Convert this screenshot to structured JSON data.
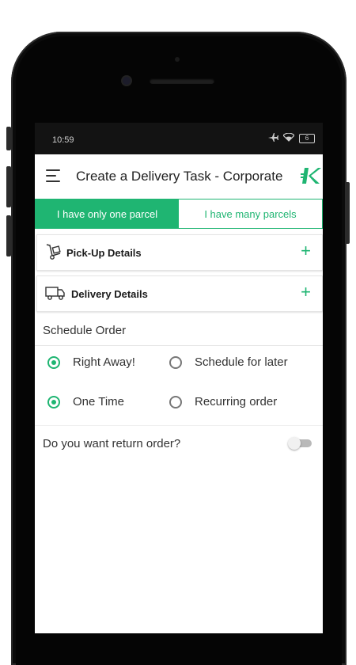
{
  "status_bar": {
    "time": "10:59",
    "battery": "6",
    "icons": [
      "airplane-icon",
      "wifi-icon",
      "battery-icon"
    ]
  },
  "appbar": {
    "title": "Create a Delivery Task - Corporate",
    "menu_icon": "hamburger-menu-icon",
    "logo_icon": "brand-k-logo-icon"
  },
  "tabs": [
    {
      "label": "I have only one parcel",
      "active": true
    },
    {
      "label": "I have many parcels",
      "active": false
    }
  ],
  "sections": {
    "pickup": {
      "label": "Pick-Up Details",
      "icon": "hand-truck-icon",
      "action": "+"
    },
    "delivery": {
      "label": "Delivery Details",
      "icon": "delivery-truck-icon",
      "action": "+"
    }
  },
  "schedule": {
    "title": "Schedule Order",
    "timing_options": [
      {
        "label": "Right Away!",
        "selected": true
      },
      {
        "label": "Schedule for later",
        "selected": false
      }
    ],
    "frequency_options": [
      {
        "label": "One Time",
        "selected": true
      },
      {
        "label": "Recurring order",
        "selected": false
      }
    ]
  },
  "return_order": {
    "label": "Do you want return order?",
    "enabled": false
  },
  "colors": {
    "accent": "#1fb572",
    "status_bar": "#131313",
    "phone_body": "#0b0b0b"
  }
}
